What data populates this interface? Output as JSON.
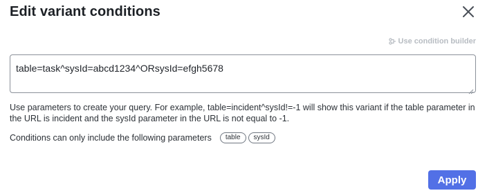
{
  "dialog": {
    "title": "Edit variant conditions",
    "close_icon": "close-icon",
    "condition_builder": {
      "icon": "condition-builder-icon",
      "label": "Use condition builder"
    },
    "query": {
      "value": "table=task^sysId=abcd1234^ORsysId=efgh5678"
    },
    "help_text": "Use parameters to create your query. For example, table=incident^sysId!=-1 will show this variant if the table parameter in the URL is incident and the sysId parameter in the URL is not equal to -1.",
    "params": {
      "label": "Conditions can only include the following parameters",
      "chips": [
        "table",
        "sysId"
      ]
    },
    "apply_label": "Apply"
  },
  "colors": {
    "accent": "#5270e6",
    "link_disabled": "#b7bcc2",
    "border": "#8a9099"
  }
}
